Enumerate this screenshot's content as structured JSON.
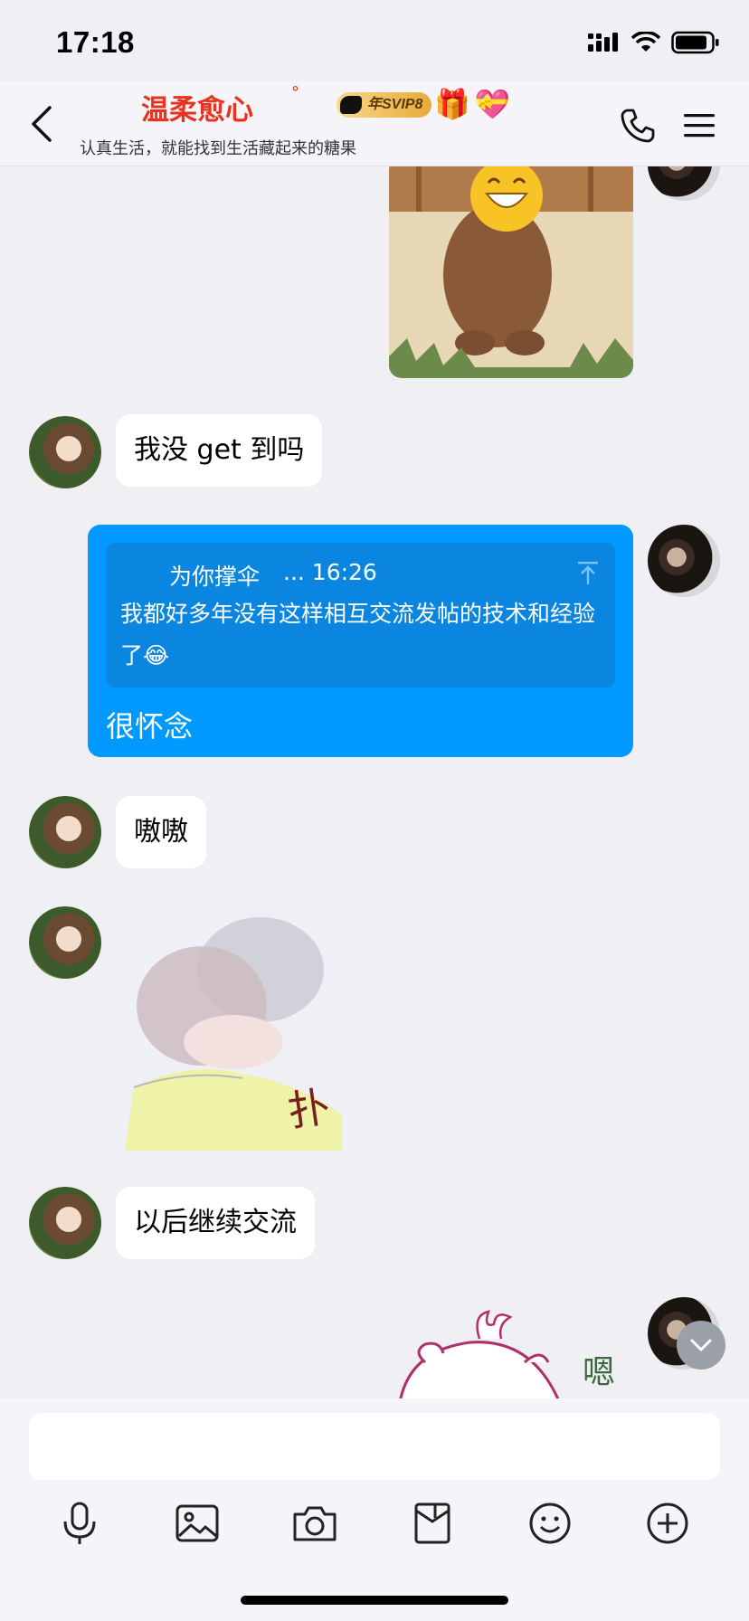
{
  "status_bar": {
    "time": "17:18"
  },
  "header": {
    "title": "温柔愈心",
    "title_mark": "°",
    "vip_badge": "年SVIP8",
    "signature": "认真生活，就能找到生活藏起来的糖果"
  },
  "messages": [
    {
      "id": "m1",
      "side": "left",
      "type": "text",
      "text": "我没 get 到吗"
    },
    {
      "id": "m2",
      "side": "right",
      "type": "quote_reply",
      "quote_author": "为你撑伞",
      "quote_time": "... 16:26",
      "quote_text": "我都好多年没有这样相互交流发帖的技术和经验了😂",
      "reply": "很怀念"
    },
    {
      "id": "m3",
      "side": "left",
      "type": "text",
      "text": "嗷嗷"
    },
    {
      "id": "m4",
      "side": "left",
      "type": "sticker",
      "sticker_text": "扑"
    },
    {
      "id": "m5",
      "side": "left",
      "type": "text",
      "text": "以后继续交流"
    },
    {
      "id": "m6",
      "side": "right",
      "type": "sticker",
      "sticker_text": "嗯"
    }
  ],
  "input": {
    "value": "",
    "placeholder": ""
  },
  "toolbar": [
    "microphone-icon",
    "image-icon",
    "camera-icon",
    "red-packet-icon",
    "emoji-icon",
    "plus-icon"
  ]
}
